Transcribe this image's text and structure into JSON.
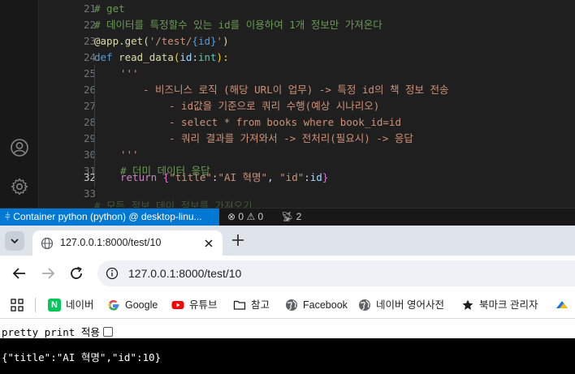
{
  "editor": {
    "line_numbers": [
      "21",
      "22",
      "23",
      "24",
      "25",
      "26",
      "27",
      "28",
      "29",
      "30",
      "31",
      "32",
      "33"
    ],
    "active_line": "32",
    "lines": {
      "l21": "# get",
      "l22": "# 데이터를 특정할수 있는 id를 이용하여 1개 정보만 가져온다",
      "l23_dec": "@app.get(",
      "l23_str_a": "'/test/",
      "l23_str_b": "{id}",
      "l23_str_c": "'",
      "l23_close": ")",
      "l24_def": "def",
      "l24_fn": "read_data",
      "l24_open": "(",
      "l24_param": "id",
      "l24_colon": ":",
      "l24_type": "int",
      "l24_close": "):",
      "l25": "'''",
      "l26": "- 비즈니스 로직 (해당 URL이 업무) -> 특정 id의 책 정보 전송",
      "l27": "- id값을 기준으로 쿼리 수행(예상 시나리오)",
      "l28": "- select * from books where book_id=id",
      "l29": "- 쿼리 결과를 가져와서 -> 전처리(필요시) -> 응답",
      "l30": "'''",
      "l31": "# 더미 데이터 응답",
      "l32_kw": "return",
      "l32_open": "{",
      "l32_k1": "\"title\"",
      "l32_colon1": ":",
      "l32_v1": "\"AI 혁명\"",
      "l32_comma": ", ",
      "l32_k2": "\"id\"",
      "l32_colon2": ":",
      "l32_v2": "id",
      "l32_close": "}",
      "l34_partial": "# 모든 정보 데이 정보를 가져오기"
    }
  },
  "statusbar": {
    "remote_label": "Container python (python) @ desktop-linu...",
    "errors": "0",
    "warnings": "0",
    "ports": "2"
  },
  "browser": {
    "tab_title": "127.0.0.1:8000/test/10",
    "url": "127.0.0.1:8000/test/10",
    "bookmarks": [
      {
        "label": "네이버",
        "icon": "naver-icon"
      },
      {
        "label": "Google",
        "icon": "google-icon"
      },
      {
        "label": "유튜브",
        "icon": "youtube-icon"
      },
      {
        "label": "참고",
        "icon": "folder-icon"
      },
      {
        "label": "Facebook",
        "icon": "globe-icon"
      },
      {
        "label": "네이버 영어사전",
        "icon": "globe-icon"
      },
      {
        "label": "북마크 관리자",
        "icon": "star-icon"
      }
    ],
    "pretty_print_label": "pretty print 적용",
    "json_output": "{\"title\":\"AI 혁명\",\"id\":10}"
  },
  "colors": {
    "remote_bg": "#0078d4",
    "naver_green": "#03c75a",
    "youtube_red": "#ff0000"
  }
}
